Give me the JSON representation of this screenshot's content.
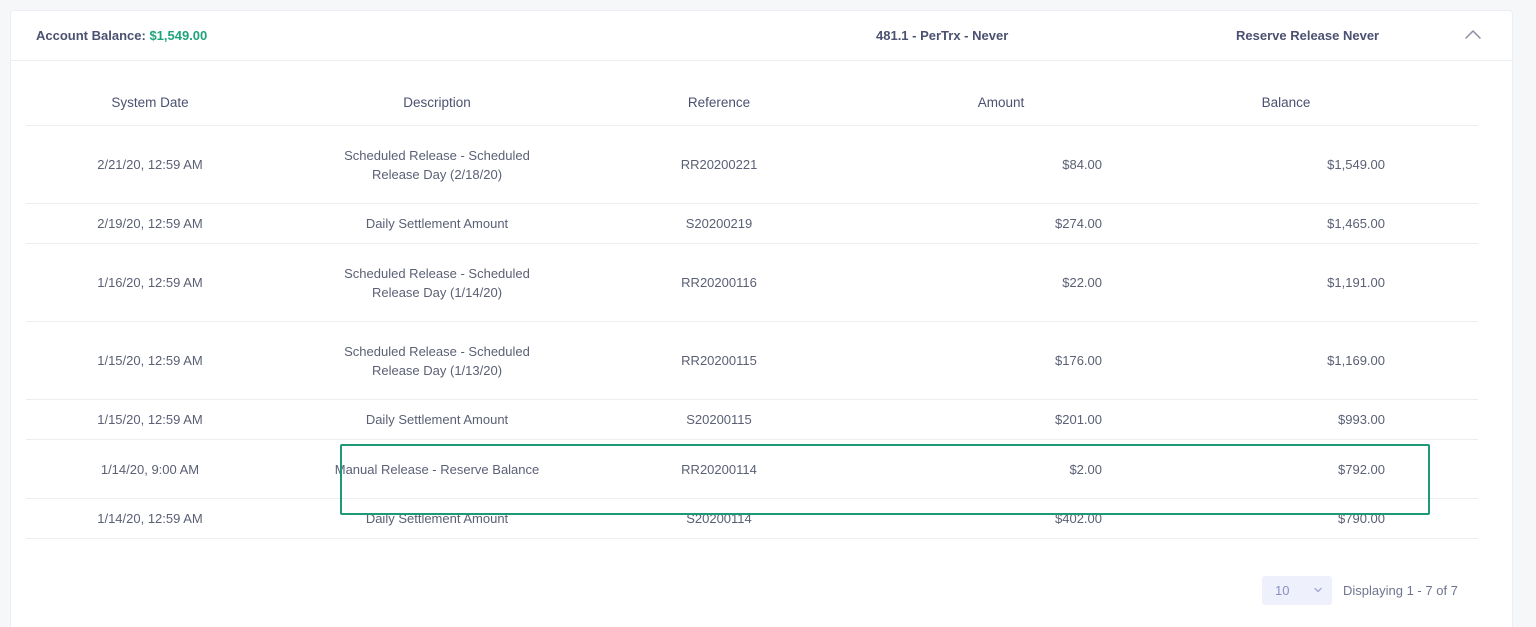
{
  "header": {
    "balance_label": "Account Balance:",
    "balance_value": "$1,549.00",
    "plan": "481.1 - PerTrx - Never",
    "reserve": "Reserve Release Never",
    "collapse_icon": "chevron-up-icon"
  },
  "table": {
    "columns": [
      "System Date",
      "Description",
      "Reference",
      "Amount",
      "Balance"
    ],
    "rows": [
      {
        "date": "2/21/20, 12:59 AM",
        "description": "Scheduled Release - Scheduled Release Day (2/18/20)",
        "reference": "RR20200221",
        "amount": "$84.00",
        "balance": "$1,549.00"
      },
      {
        "date": "2/19/20, 12:59 AM",
        "description": "Daily Settlement Amount",
        "reference": "S20200219",
        "amount": "$274.00",
        "balance": "$1,465.00"
      },
      {
        "date": "1/16/20, 12:59 AM",
        "description": "Scheduled Release - Scheduled Release Day (1/14/20)",
        "reference": "RR20200116",
        "amount": "$22.00",
        "balance": "$1,191.00"
      },
      {
        "date": "1/15/20, 12:59 AM",
        "description": "Scheduled Release - Scheduled Release Day (1/13/20)",
        "reference": "RR20200115",
        "amount": "$176.00",
        "balance": "$1,169.00"
      },
      {
        "date": "1/15/20, 12:59 AM",
        "description": "Daily Settlement Amount",
        "reference": "S20200115",
        "amount": "$201.00",
        "balance": "$993.00"
      },
      {
        "date": "1/14/20, 9:00 AM",
        "description": "Manual Release - Reserve Balance",
        "reference": "RR20200114",
        "amount": "$2.00",
        "balance": "$792.00"
      },
      {
        "date": "1/14/20, 12:59 AM",
        "description": "Daily Settlement Amount",
        "reference": "S20200114",
        "amount": "$402.00",
        "balance": "$790.00"
      }
    ]
  },
  "pager": {
    "page_size": "10",
    "info": "Displaying 1 - 7 of 7"
  },
  "colors": {
    "accent_green": "#1fa37a",
    "highlight_border": "#1e9978"
  }
}
